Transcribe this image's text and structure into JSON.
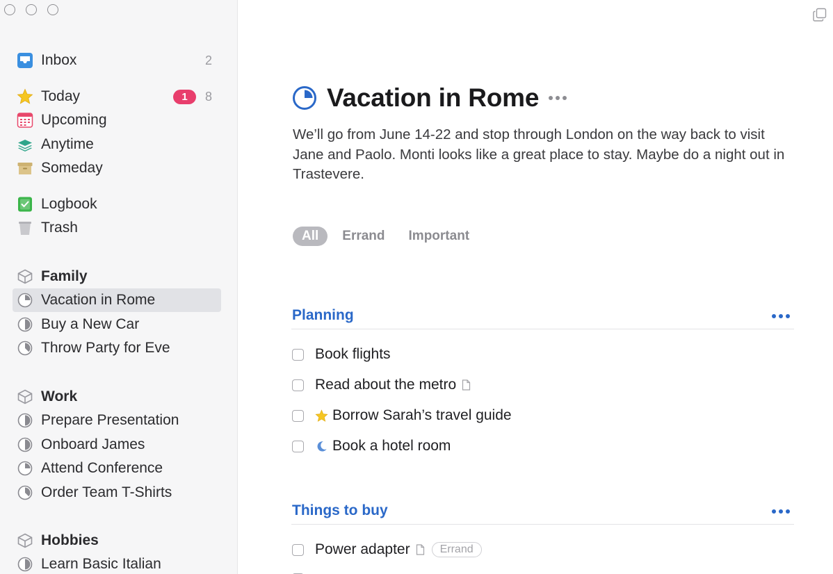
{
  "window": {
    "controls": [
      "close",
      "minimize",
      "zoom"
    ]
  },
  "sidebar": {
    "inbox": {
      "label": "Inbox",
      "count": "2",
      "icon": "inbox-icon"
    },
    "today": {
      "label": "Today",
      "badge": "1",
      "count": "8",
      "icon": "star-icon"
    },
    "upcoming": {
      "label": "Upcoming",
      "icon": "calendar-icon"
    },
    "anytime": {
      "label": "Anytime",
      "icon": "layers-icon"
    },
    "someday": {
      "label": "Someday",
      "icon": "archive-box-icon"
    },
    "logbook": {
      "label": "Logbook",
      "icon": "logbook-icon"
    },
    "trash": {
      "label": "Trash",
      "icon": "trash-icon"
    },
    "areas": [
      {
        "label": "Family",
        "projects": [
          "Vacation in Rome",
          "Buy a New Car",
          "Throw Party for Eve"
        ]
      },
      {
        "label": "Work",
        "projects": [
          "Prepare Presentation",
          "Onboard James",
          "Attend Conference",
          "Order Team T-Shirts"
        ]
      },
      {
        "label": "Hobbies",
        "projects": [
          "Learn Basic Italian"
        ]
      }
    ],
    "selected_project": "Vacation in Rome"
  },
  "project": {
    "title": "Vacation in Rome",
    "notes": "We’ll go from June 14-22 and stop through London on the way back to visit Jane and Paolo. Monti looks like a great place to stay. Maybe do a night out in Trastevere.",
    "tag_filters": [
      "All",
      "Errand",
      "Important"
    ],
    "active_filter": "All"
  },
  "headings": [
    {
      "title": "Planning",
      "todos": [
        {
          "title": "Book flights"
        },
        {
          "title": "Read about the metro",
          "has_note": true
        },
        {
          "title": "Borrow Sarah’s travel guide",
          "prefix_icon": "star-icon"
        },
        {
          "title": "Book a hotel room",
          "prefix_icon": "moon-icon"
        }
      ]
    },
    {
      "title": "Things to buy",
      "todos": [
        {
          "title": "Power adapter",
          "has_note": true,
          "tag": "Errand"
        }
      ]
    }
  ],
  "colors": {
    "accent_blue": "#2a68c8",
    "badge_pink": "#e83e6c",
    "sidebar_bg": "#f6f6f7",
    "selected_bg": "#e1e2e6"
  }
}
